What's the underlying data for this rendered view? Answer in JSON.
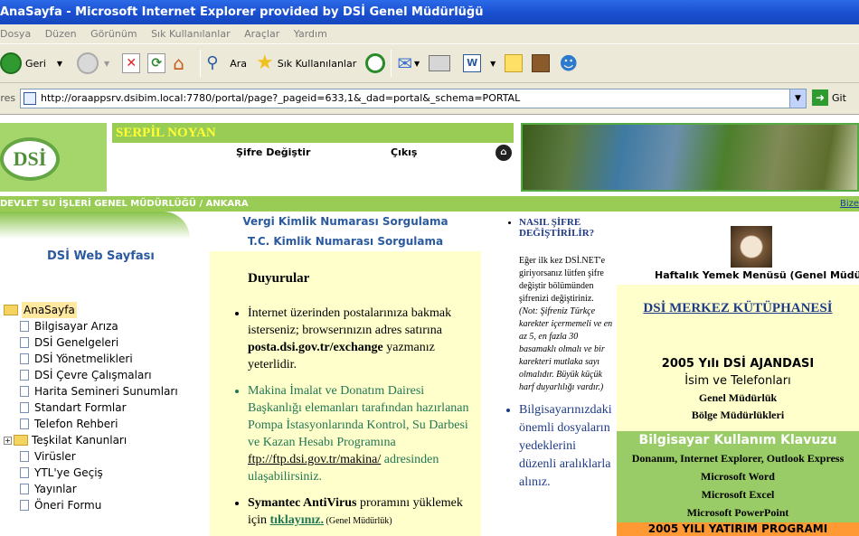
{
  "window": {
    "title": "AnaSayfa - Microsoft Internet Explorer provided by DSİ Genel Müdürlüğü"
  },
  "menu": [
    "Dosya",
    "Düzen",
    "Görünüm",
    "Sık Kullanılanlar",
    "Araçlar",
    "Yardım"
  ],
  "toolbar": {
    "back": "Geri",
    "search": "Ara",
    "favorites": "Sık Kullanılanlar"
  },
  "address": {
    "label": "Adres",
    "url": "http://oraappsrv.dsibim.local:7780/portal/page?_pageid=633,1&_dad=portal&_schema=PORTAL",
    "go": "Git"
  },
  "header": {
    "logo_text": "DSİ",
    "user_name": "SERPİL NOYAN",
    "change_password": "Şifre Değiştir",
    "logout": "Çıkış",
    "org_bar": "DEVLET SU İŞLERİ GENEL MÜDÜRLÜĞÜ / ANKARA",
    "bize": "Bize"
  },
  "left": {
    "title": "DSİ Web Sayfası",
    "tree": [
      {
        "label": "AnaSayfa",
        "type": "folder-root"
      },
      {
        "label": "Bilgisayar Arıza",
        "type": "doc"
      },
      {
        "label": "DSİ Genelgeleri",
        "type": "doc"
      },
      {
        "label": "DSİ Yönetmelikleri",
        "type": "doc"
      },
      {
        "label": "DSİ Çevre Çalışmaları",
        "type": "doc"
      },
      {
        "label": "Harita Semineri Sunumları",
        "type": "doc"
      },
      {
        "label": "Standart Formlar",
        "type": "doc"
      },
      {
        "label": "Telefon Rehberi",
        "type": "doc"
      },
      {
        "label": "Teşkilat Kanunları",
        "type": "folder"
      },
      {
        "label": "Virüsler",
        "type": "doc"
      },
      {
        "label": "YTL'ye Geçiş",
        "type": "doc"
      },
      {
        "label": "Yayınlar",
        "type": "doc"
      },
      {
        "label": "Öneri Formu",
        "type": "doc"
      }
    ]
  },
  "center": {
    "link1": "Vergi Kimlik Numarası Sorgulama",
    "link2": "T.C. Kimlik Numarası Sorgulama",
    "duyuru_title": "Duyurular",
    "item1_a": "İnternet üzerinden postalarınıza bakmak isterseniz; browserınızın adres satırına ",
    "item1_b": "posta.dsi.gov.tr/exchange",
    "item1_c": " yazmanız yeterlidir.",
    "item2_a": "Makina İmalat ve Donatım Dairesi Başkanlığı elemanları tarafından hazırlanan Pompa İstasyonlarında Kontrol, Su Darbesi ve Kazan Hesabı Programına ",
    "item2_b": "ftp://ftp.dsi.gov.tr/makina/",
    "item2_c": " adresinden ulaşabilirsiniz.",
    "item3_a": "Symantec AntiVirus",
    "item3_b": " proramını yüklemek için ",
    "item3_c": "tıklayınız.",
    "item3_d": " (Genel Müdürlük)"
  },
  "col3": {
    "heading": "NASIL ŞİFRE DEĞİŞTİRİLİR?",
    "text": "Eğer ilk kez DSİ.NET'e giriyorsanız lütfen şifre değiştir bölümünden şifrenizi değiştiriniz.",
    "note": "(Not: Şifreniz Türkçe karekter içermemeli ve en az 5, en fazla 30 basamaklı olmalı ve bir karekteri mutlaka sayı olmalıdır. Büyük küçük harf duyarlılığı vardır.)",
    "backup": "Bilgisayarınızdaki önemli dosyaların yedeklerini düzenli aralıklarla alınız."
  },
  "right": {
    "menu_caption": "Haftalık Yemek Menüsü (Genel Müdürlük)",
    "library": "DSİ MERKEZ KÜTÜPHANESİ",
    "ajanda_title": "2005 Yılı DSİ AJANDASI",
    "ajanda_sub": "İsim ve Telefonları",
    "ajanda_gm": "Genel Müdürlük",
    "ajanda_bolge": "Bölge Müdürlükleri",
    "klavuz_title": "Bilgisayar Kullanım Klavuzu",
    "klavuz_1": "Donanım, Internet Explorer, Outlook Express",
    "klavuz_2": "Microsoft Word",
    "klavuz_3": "Microsoft Excel",
    "klavuz_4": "Microsoft PowerPoint",
    "yatirim": "2005 YILI YATIRIM PROGRAMI"
  }
}
